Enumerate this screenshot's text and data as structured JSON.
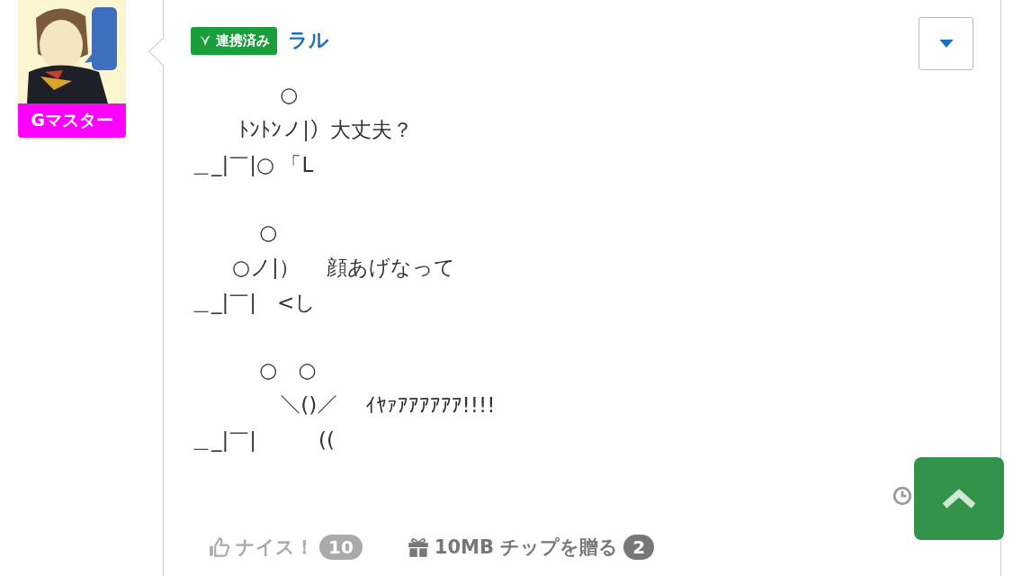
{
  "user": {
    "title_badge": "Gマスター"
  },
  "post": {
    "linked_badge": "連携済み",
    "author": "ラル",
    "stanzas": [
      [
        "　　　　 ○",
        "　　 ﾄﾝﾄﾝノ|）大丈夫？",
        "＿_|￣|○ 「L"
      ],
      [
        "　　　 ○",
        "　　○ノ|）　 顔あげなって",
        "＿_|￣|　<し"
      ],
      [
        "　　　 ○　○",
        "　　　　 ＼()／　 ｲﾔｧｱｱｱｱｱｱ!!!!",
        "＿_|￣|　　　(("
      ]
    ],
    "nice": {
      "label": "ナイス！",
      "count": "10"
    },
    "gift": {
      "label": "10MB チップを贈る",
      "count": "2"
    }
  }
}
